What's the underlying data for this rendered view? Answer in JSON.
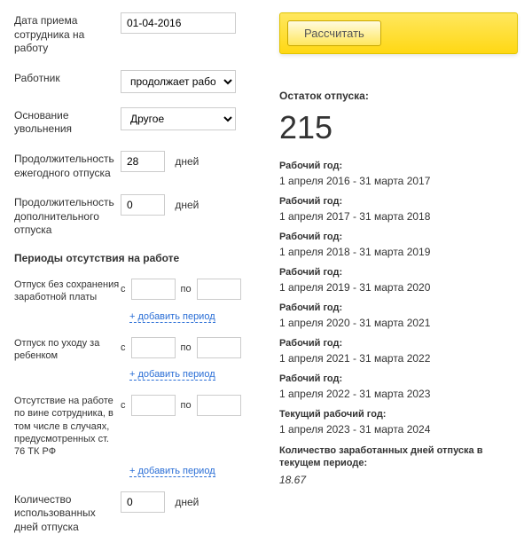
{
  "form": {
    "hire_date_label": "Дата приема сотрудника на работу",
    "hire_date_value": "01-04-2016",
    "employee_label": "Работник",
    "employee_value": "продолжает работать",
    "dismissal_label": "Основание увольнения",
    "dismissal_value": "Другое",
    "annual_leave_label": "Продолжительность ежегодного отпуска",
    "annual_leave_value": "28",
    "additional_leave_label": "Продолжительность дополнительного отпуска",
    "additional_leave_value": "0",
    "days_unit": "дней",
    "absence_title": "Периоды отсутствия на работе",
    "from_label": "с",
    "to_label": "по",
    "add_period": "+ добавить период",
    "unpaid_leave_label": "Отпуск без сохранения заработной платы",
    "child_leave_label": "Отпуск по уходу за ребенком",
    "fault_absence_label": "Отсутствие на работе по вине сотрудника, в том числе в случаях, предусмотренных ст. 76 ТК РФ",
    "used_days_label": "Количество использованных дней отпуска",
    "used_days_value": "0"
  },
  "results": {
    "calculate_btn": "Рассчитать",
    "remainder_label": "Остаток отпуска:",
    "remainder_value": "215",
    "year_label": "Рабочий год:",
    "current_year_label": "Текущий рабочий год:",
    "years": [
      "1 апреля 2016 - 31 марта 2017",
      "1 апреля 2017 - 31 марта 2018",
      "1 апреля 2018 - 31 марта 2019",
      "1 апреля 2019 - 31 марта 2020",
      "1 апреля 2020 - 31 марта 2021",
      "1 апреля 2021 - 31 марта 2022",
      "1 апреля 2022 - 31 марта 2023"
    ],
    "current_year": "1 апреля 2023 - 31 марта 2024",
    "earned_label": "Количество заработанных дней отпуска в текущем периоде:",
    "earned_value": "18.67"
  }
}
